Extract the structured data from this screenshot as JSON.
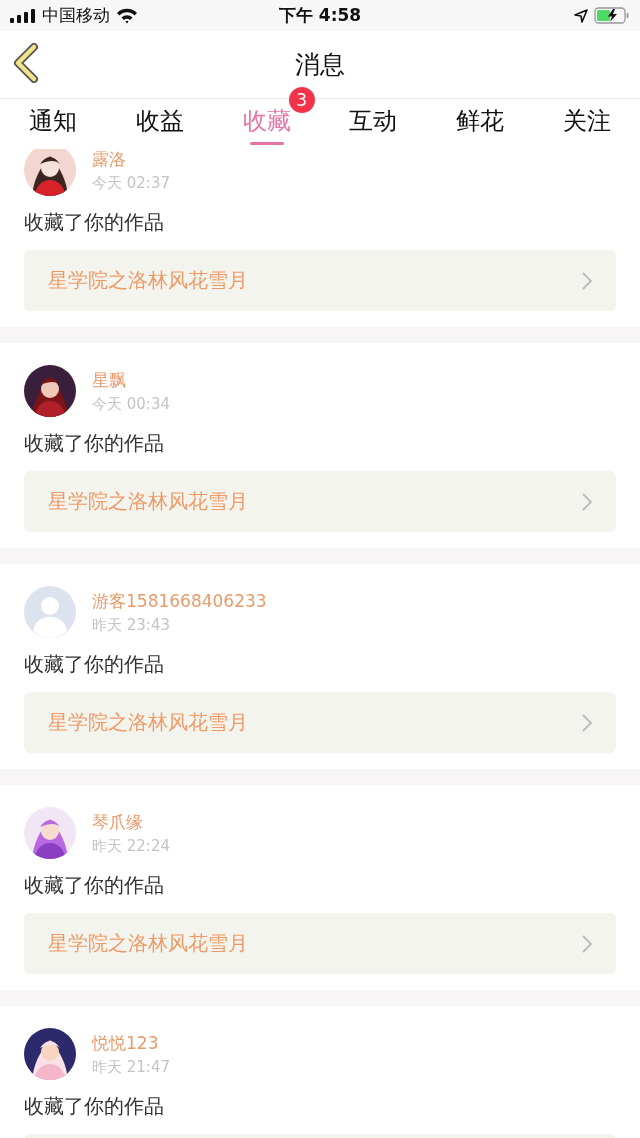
{
  "status_bar": {
    "carrier": "中国移动",
    "time": "下午 4:58"
  },
  "header": {
    "title": "消息"
  },
  "tabs": [
    {
      "label": "通知",
      "selected": false
    },
    {
      "label": "收益",
      "selected": false
    },
    {
      "label": "收藏",
      "selected": true,
      "badge": "3"
    },
    {
      "label": "互动",
      "selected": false
    },
    {
      "label": "鲜花",
      "selected": false
    },
    {
      "label": "关注",
      "selected": false
    }
  ],
  "messages": [
    {
      "name": "露洛",
      "time": "今天 02:37",
      "text": "收藏了你的作品",
      "work": "星学院之洛林风花雪月"
    },
    {
      "name": "星飘",
      "time": "今天 00:34",
      "text": "收藏了你的作品",
      "work": "星学院之洛林风花雪月"
    },
    {
      "avatar": {
        "kind": "default"
      },
      "name": "游客1581668406233",
      "time": "昨天 23:43",
      "text": "收藏了你的作品",
      "work": "星学院之洛林风花雪月"
    },
    {
      "name": "琴爪缘",
      "time": "昨天 22:24",
      "text": "收藏了你的作品",
      "work": "星学院之洛林风花雪月"
    },
    {
      "name": "悦悦123",
      "time": "昨天 21:47",
      "text": "收藏了你的作品"
    }
  ]
}
